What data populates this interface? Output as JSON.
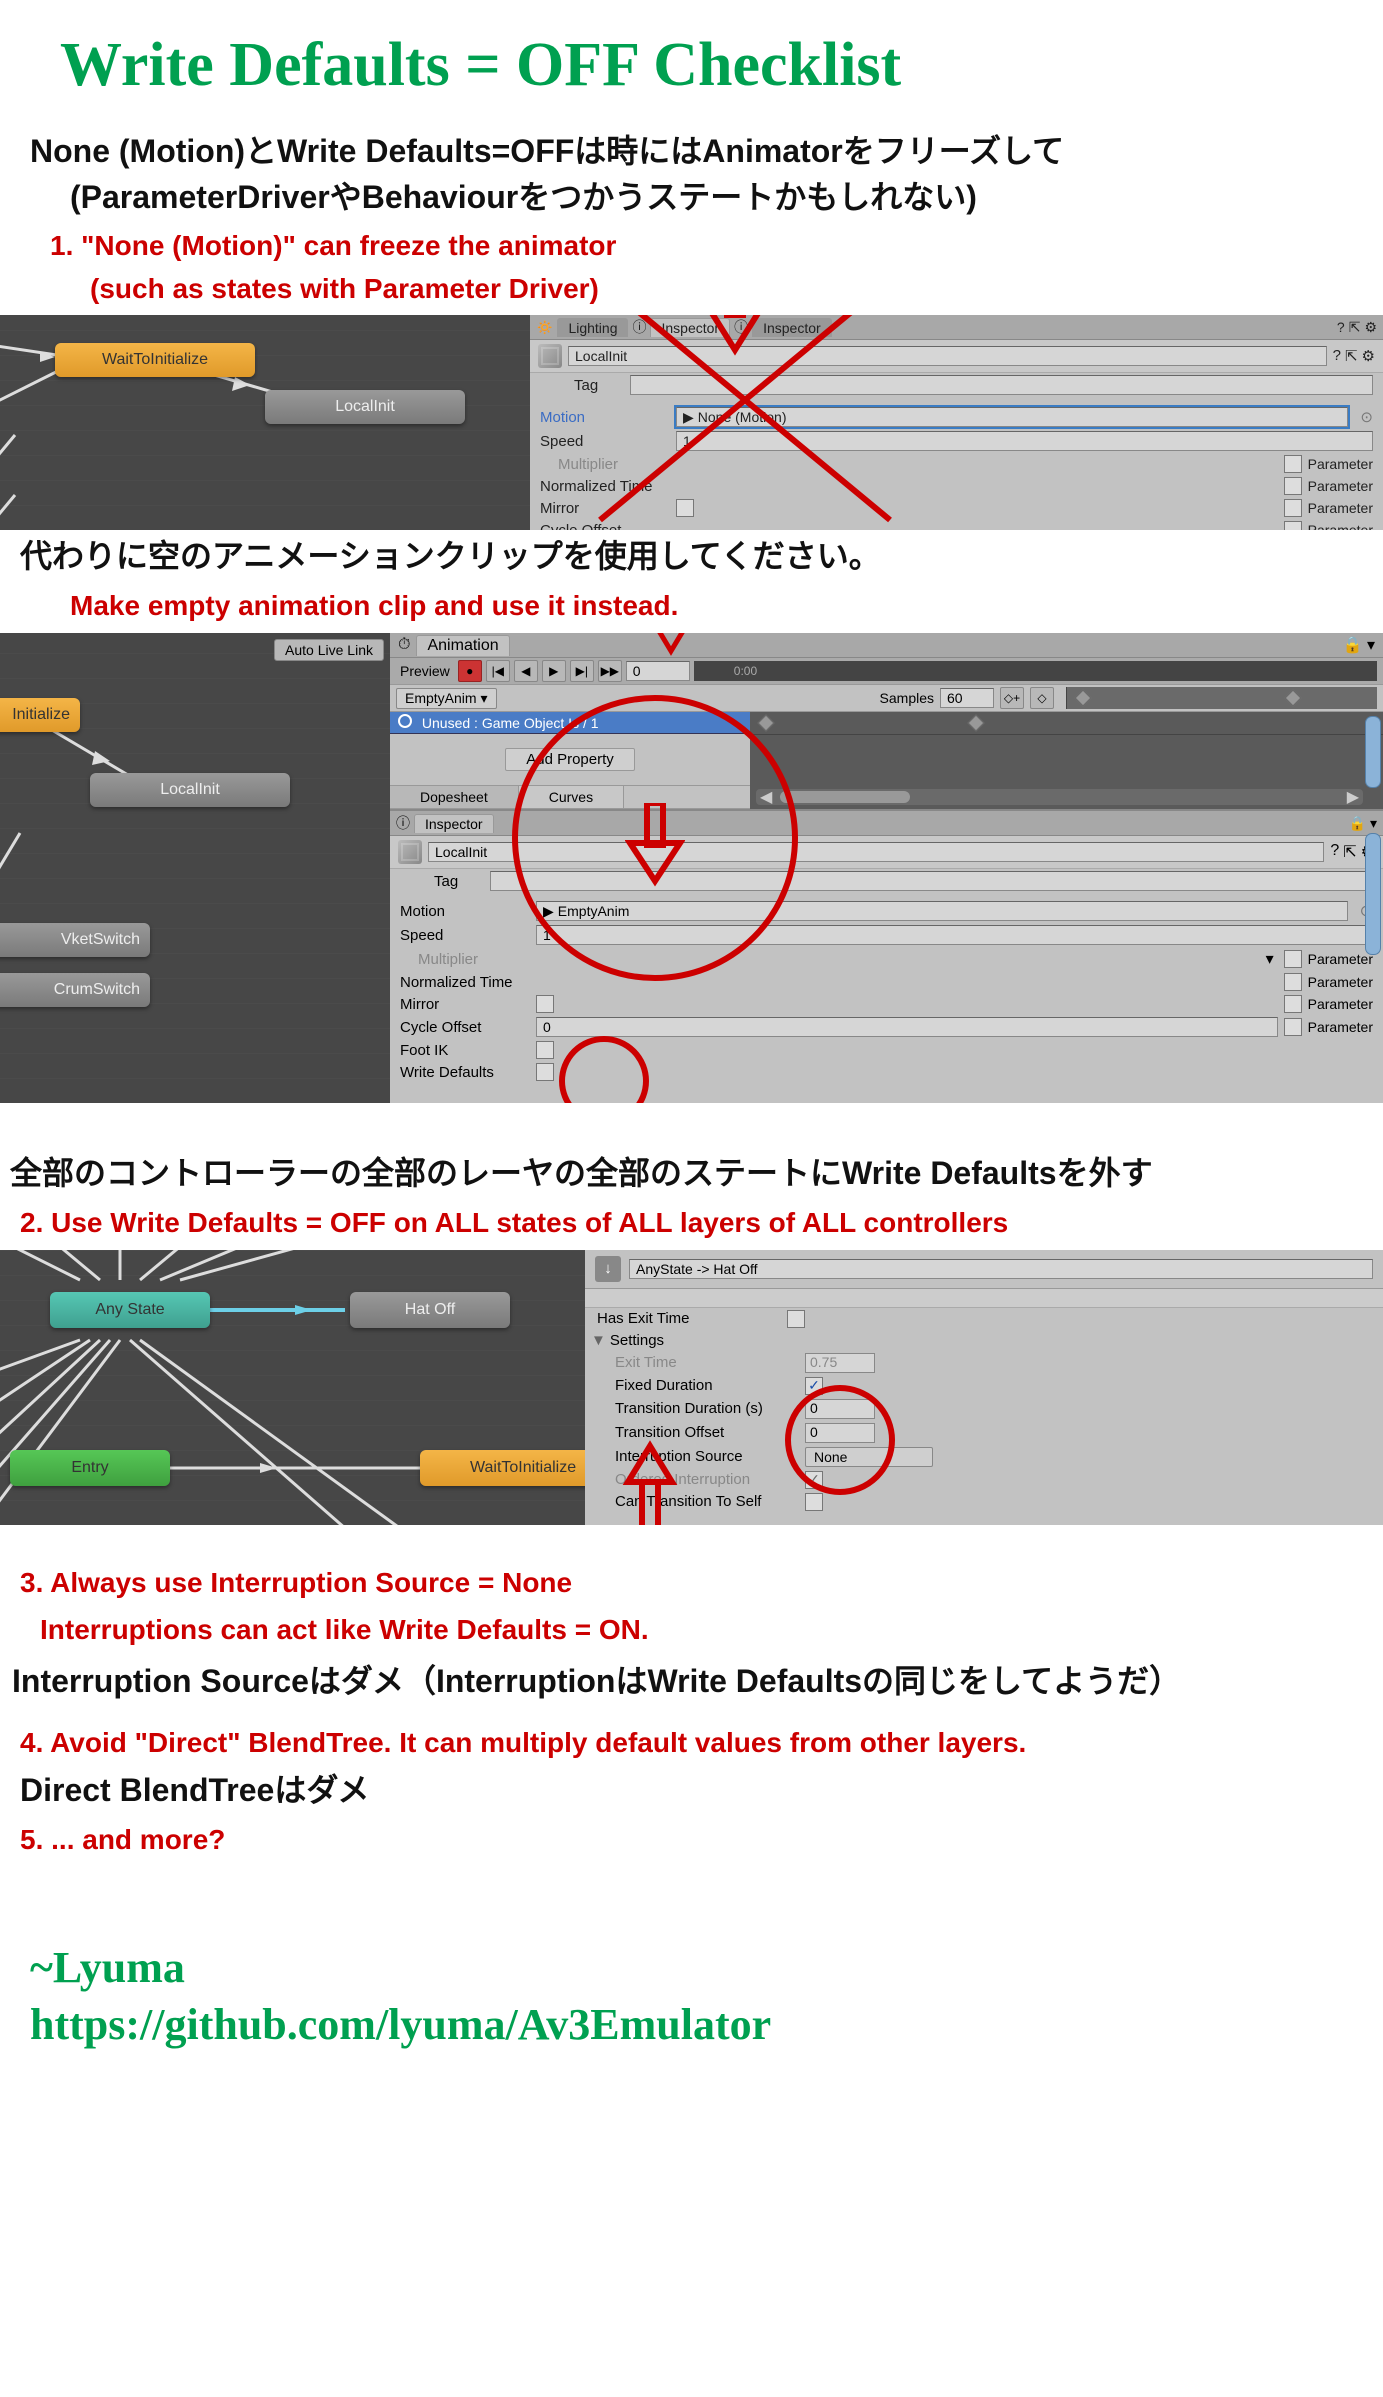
{
  "title": "Write Defaults = OFF Checklist",
  "note_jp_1a": "None (Motion)とWrite Defaults=OFFは時にはAnimatorをフリーズして",
  "note_jp_1b": "(ParameterDriverやBehaviourをつかうステートかもしれない)",
  "item1": "1. \"None (Motion)\" can freeze the animator",
  "item1_sub": "(such as states with Parameter Driver)",
  "shot1": {
    "nodes": {
      "wait": "WaitToInitialize",
      "local": "LocalInit"
    },
    "tabs": {
      "lighting": "Lighting",
      "inspector": "Inspector",
      "inspector2": "Inspector"
    },
    "state_name": "LocalInit",
    "tag_label": "Tag",
    "motion_label": "Motion",
    "motion_value": "None (Motion)",
    "speed_label": "Speed",
    "speed_value": "1",
    "multiplier_label": "Multiplier",
    "normtime_label": "Normalized Time",
    "mirror_label": "Mirror",
    "cycle_label": "Cycle Offset",
    "parameter_label": "Parameter"
  },
  "jp_2": "代わりに空のアニメーションクリップを使用してください。",
  "item2_red": "Make empty animation clip and use it instead.",
  "shot2": {
    "auto_live": "Auto Live Link",
    "nodes": {
      "init": "Initialize",
      "local": "LocalInit",
      "vket": "VketSwitch",
      "crum": "CrumSwitch"
    },
    "animation_tab": "Animation",
    "preview": "Preview",
    "clip_name": "EmptyAnim",
    "samples_label": "Samples",
    "samples_value": "60",
    "time0": "0:00",
    "frame_value": "0",
    "track": "Unused : Game Object.Is / 1",
    "add_property": "Add Property",
    "dopesheet": "Dopesheet",
    "curves": "Curves",
    "inspector_tab": "Inspector",
    "state_name": "LocalInit",
    "tag_label": "Tag",
    "motion_label": "Motion",
    "motion_value": "EmptyAnim",
    "speed_label": "Speed",
    "speed_value": "1",
    "multiplier_label": "Multiplier",
    "normtime_label": "Normalized Time",
    "mirror_label": "Mirror",
    "cycle_label": "Cycle Offset",
    "cycle_value": "0",
    "footik_label": "Foot IK",
    "writedef_label": "Write Defaults",
    "parameter_label": "Parameter"
  },
  "jp_3": "全部のコントローラーの全部のレーヤの全部のステートにWrite Defaultsを外す",
  "item2": "2. Use Write Defaults = OFF on ALL states of ALL layers of ALL controllers",
  "shot3": {
    "nodes": {
      "any": "Any State",
      "hat": "Hat Off",
      "entry": "Entry",
      "wait": "WaitToInitialize"
    },
    "trans_name": "AnyState -> Hat Off",
    "has_exit": "Has Exit Time",
    "settings": "Settings",
    "exit_time": "Exit Time",
    "exit_time_v": "0.75",
    "fixed_dur": "Fixed Duration",
    "trans_dur": "Transition Duration (s)",
    "trans_dur_v": "0",
    "trans_off": "Transition Offset",
    "trans_off_v": "0",
    "int_src": "Interruption Source",
    "int_src_v": "None",
    "ordered": "Ordered Interruption",
    "can_self": "Can Transition To Self"
  },
  "item3": "3. Always use Interruption Source = None",
  "item3_sub": "Interruptions can act like Write Defaults = ON.",
  "jp_4": "Interruption Sourceはダメ（InterruptionはWrite Defaultsの同じをしてようだ）",
  "item4": "4. Avoid \"Direct\" BlendTree. It can multiply default values from other layers.",
  "jp_5": "Direct BlendTreeはダメ",
  "item5": "5. ... and more?",
  "signature": "~Lyuma",
  "url": "https://github.com/lyuma/Av3Emulator"
}
